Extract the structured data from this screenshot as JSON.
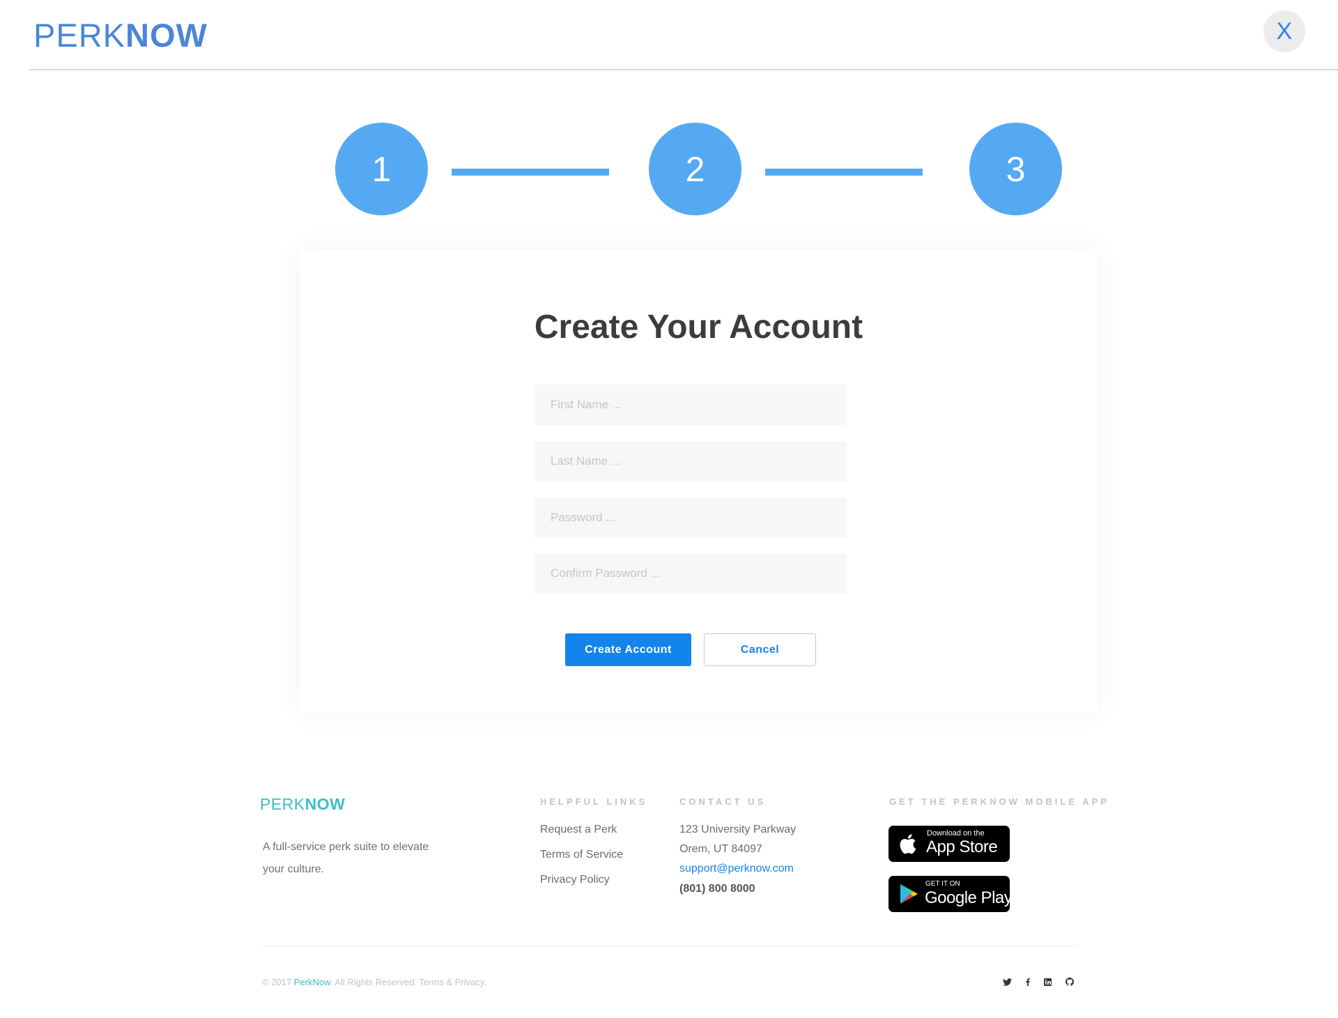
{
  "header": {
    "logo_perk": "PERK",
    "logo_now": "NOW",
    "close_label": "X"
  },
  "stepper": {
    "steps": [
      "1",
      "2",
      "3"
    ],
    "color": "#55a9f2"
  },
  "form": {
    "title": "Create Your Account",
    "fields": [
      {
        "placeholder": "First Name ...",
        "value": ""
      },
      {
        "placeholder": "Last Name ...",
        "value": ""
      },
      {
        "placeholder": "Password ...",
        "value": ""
      },
      {
        "placeholder": "Confirm Password ...",
        "value": ""
      }
    ],
    "submit_label": "Create Account",
    "cancel_label": "Cancel",
    "accent": "#1384ec"
  },
  "footer": {
    "logo_perk": "PERK",
    "logo_now": "NOW",
    "tagline": "A full-service perk suite to elevate your culture.",
    "links_heading": "HELPFUL LINKS",
    "links": [
      "Request a Perk",
      "Terms of Service",
      "Privacy Policy"
    ],
    "contact_heading": "CONTACT US",
    "contact": {
      "address_line1": "123 University Parkway",
      "address_line2": "Orem, UT 84097",
      "email": "support@perknow.com",
      "phone": "(801) 800 8000"
    },
    "app_heading": "GET THE PERKNOW MOBILE APP",
    "app_store": {
      "small": "Download on the",
      "big": "App Store"
    },
    "google_play": {
      "small": "GET IT ON",
      "big": "Google Play"
    },
    "copyright_prefix": "© 2017 ",
    "copyright_brand": "PerkNow",
    "copyright_suffix": ". All Rights Reserved. Terms & Privacy.",
    "social_icons": [
      "twitter-icon",
      "facebook-icon",
      "linkedin-icon",
      "github-icon"
    ],
    "brand_color": "#3bbfc4"
  }
}
